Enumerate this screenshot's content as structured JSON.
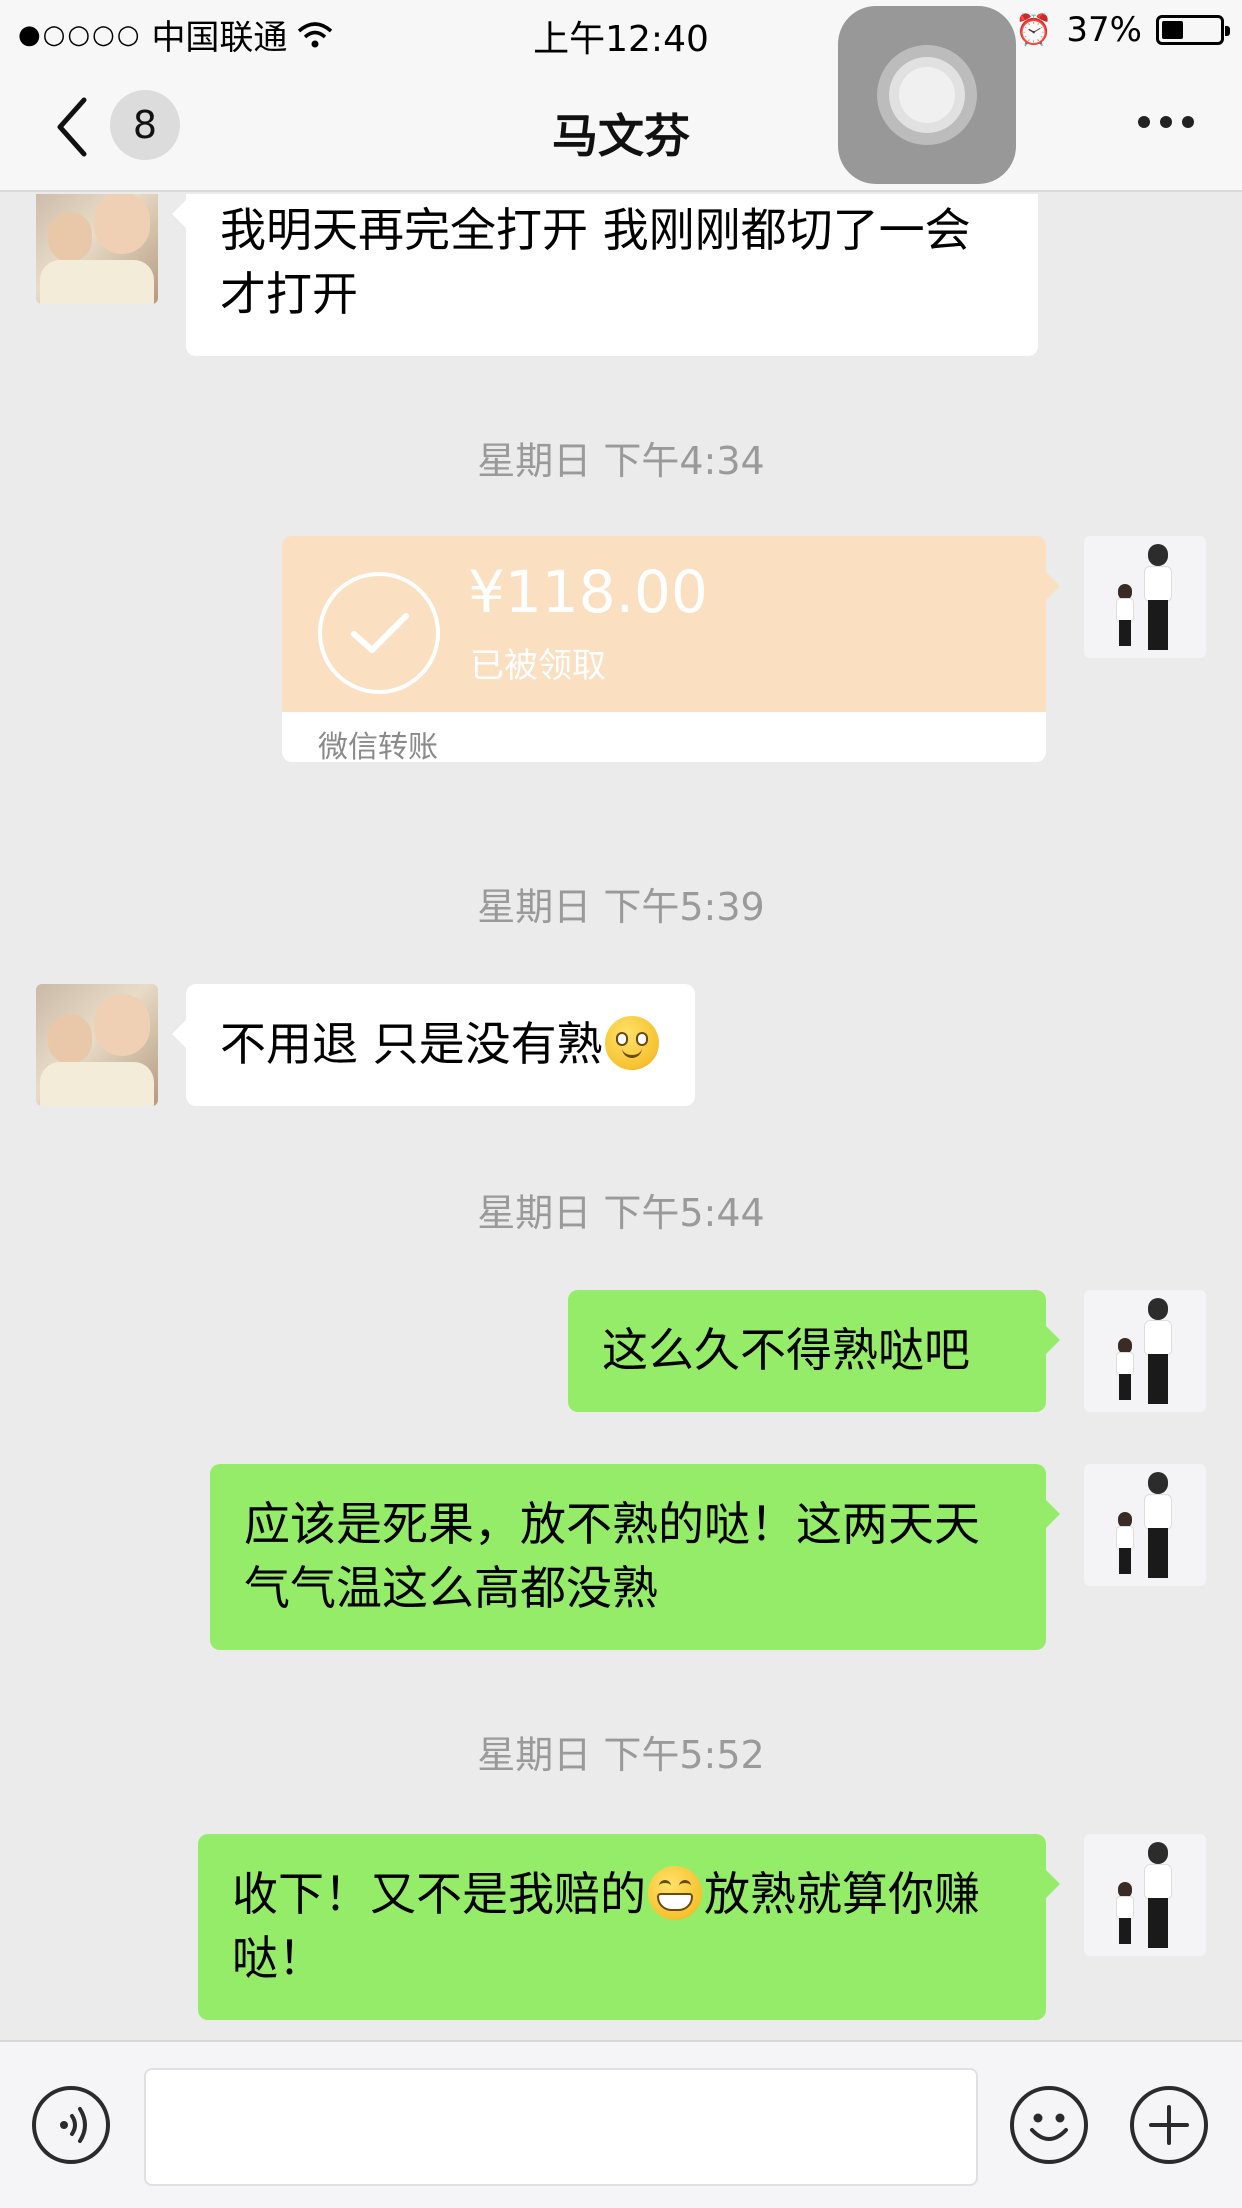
{
  "status_bar": {
    "carrier": "中国联通",
    "signal_dots": "●○○○○",
    "time": "上午12:40",
    "battery_percent": "37%",
    "battery_level": 0.37
  },
  "nav": {
    "unread_count": "8",
    "title": "马文芬"
  },
  "messages": [
    {
      "type": "text",
      "from": "peer",
      "text": "我明天再完全打开 我刚刚都切了一会 才打开"
    },
    {
      "type": "timestamp",
      "text": "星期日 下午4:34"
    },
    {
      "type": "transfer",
      "from": "self",
      "amount": "¥118.00",
      "status": "已被领取",
      "label": "微信转账"
    },
    {
      "type": "timestamp",
      "text": "星期日 下午5:39"
    },
    {
      "type": "text",
      "from": "peer",
      "text": "不用退 只是没有熟",
      "emoji_after": "smile"
    },
    {
      "type": "timestamp",
      "text": "星期日 下午5:44"
    },
    {
      "type": "text",
      "from": "self",
      "text": "这么久不得熟哒吧"
    },
    {
      "type": "text",
      "from": "self",
      "text": "应该是死果，放不熟的哒！这两天天气气温这么高都没熟"
    },
    {
      "type": "timestamp",
      "text": "星期日 下午5:52"
    },
    {
      "type": "text",
      "from": "self",
      "text_before": "收下！又不是我赔的",
      "emoji_inline": "grin",
      "text_after": "放熟就算你赚哒！"
    }
  ],
  "input": {
    "value": "",
    "placeholder": ""
  },
  "colors": {
    "bubble_self": "#95ec69",
    "bubble_peer": "#ffffff",
    "transfer_card": "#fbdfc1",
    "chat_background": "#ebebeb"
  },
  "icons": {
    "back": "chevron-left-icon",
    "more": "more-dots-icon",
    "voice": "voice-icon",
    "emoji": "emoji-icon",
    "plus": "plus-icon",
    "transfer_check": "check-circle-icon",
    "wifi": "wifi-icon",
    "alarm": "alarm-icon"
  }
}
